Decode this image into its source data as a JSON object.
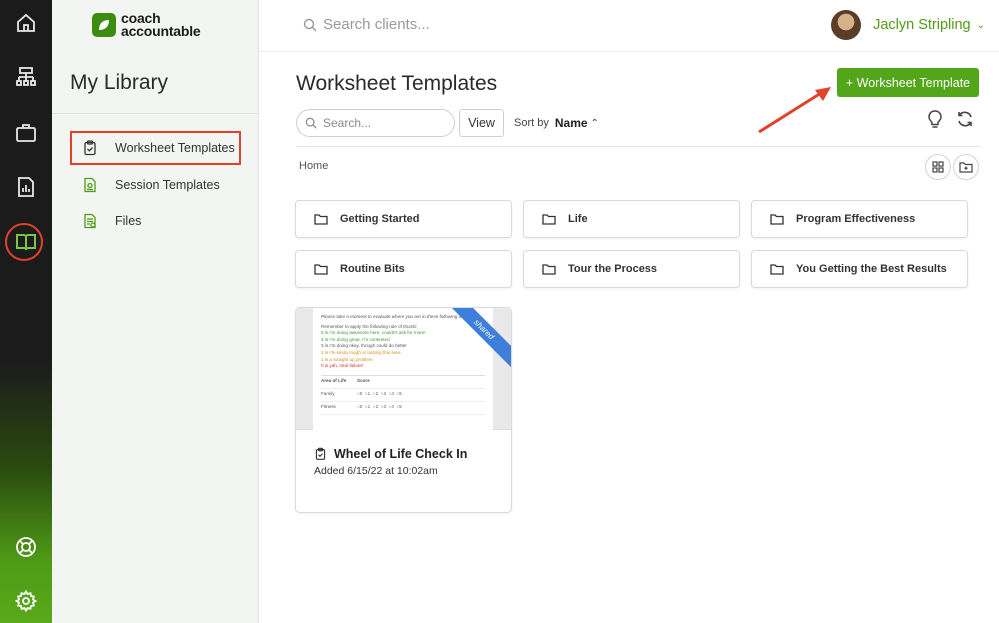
{
  "rail": {
    "icons": [
      "home-icon",
      "sitemap-icon",
      "briefcase-icon",
      "report-icon",
      "book-icon",
      "lifebuoy-icon",
      "gear-icon"
    ]
  },
  "brand": {
    "line1": "coach",
    "line2": "accountable",
    "color": "#3d8c12"
  },
  "library": {
    "title": "My Library",
    "items": [
      {
        "label": "Worksheet Templates",
        "icon": "clipboard-check-icon",
        "active": true
      },
      {
        "label": "Session Templates",
        "icon": "session-doc-icon",
        "active": false
      },
      {
        "label": "Files",
        "icon": "files-icon",
        "active": false
      }
    ]
  },
  "topbar": {
    "search_placeholder": "Search clients...",
    "user_name": "Jaclyn Stripling"
  },
  "main": {
    "title": "Worksheet Templates",
    "add_button": "+ Worksheet Template",
    "search_placeholder": "Search...",
    "view_label": "View",
    "sort_prefix": "Sort by",
    "sort_field": "Name",
    "breadcrumb": "Home"
  },
  "folders": [
    "Getting Started",
    "Life",
    "Program Effectiveness",
    "Routine Bits",
    "Tour the Process",
    "You Getting the Best Results"
  ],
  "card": {
    "title": "Wheel of Life Check In",
    "date": "Added 6/15/22 at 10:02am",
    "ribbon": "shared",
    "preview": {
      "intro": "Please take a moment to evaluate where you are in these following areas",
      "remember": "Remember to apply the following rule of thumb:",
      "lines": [
        "5 is I'm doing awesome here, couldn't ask for more!",
        "4 is I'm doing great, I'm contented",
        "3 is I'm doing okay, though could do better",
        "2 is I'm kinda rough or lacking this area",
        "1 is a straight up problem",
        "0 is yah, total failure!"
      ],
      "table_head": [
        "Area of Life",
        "Score"
      ],
      "table_rows": [
        "Family",
        "Fitness"
      ],
      "scores": [
        "0",
        "1",
        "2",
        "3",
        "4",
        "5"
      ]
    }
  },
  "colors": {
    "accent": "#53a51a",
    "highlight": "#e2412c",
    "ribbon": "#3f7fdc"
  }
}
